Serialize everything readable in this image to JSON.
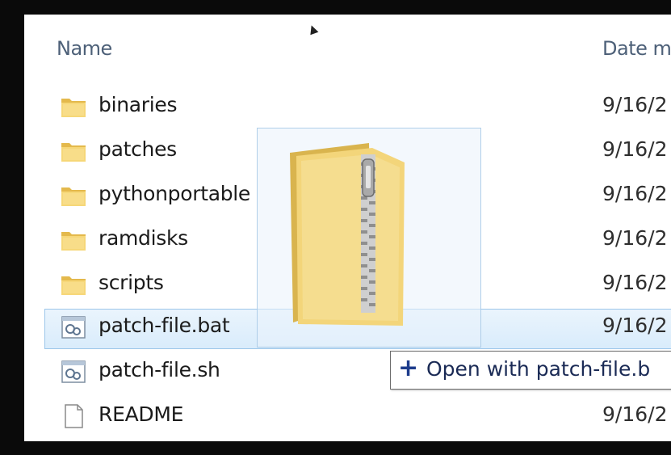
{
  "columns": {
    "name": "Name",
    "date": "Date m"
  },
  "files": [
    {
      "name": "binaries",
      "date": "9/16/2",
      "type": "folder"
    },
    {
      "name": "patches",
      "date": "9/16/2",
      "type": "folder"
    },
    {
      "name": "pythonportable",
      "date": "9/16/2",
      "type": "folder"
    },
    {
      "name": "ramdisks",
      "date": "9/16/2",
      "type": "folder"
    },
    {
      "name": "scripts",
      "date": "9/16/2",
      "type": "folder"
    },
    {
      "name": "patch-file.bat",
      "date": "9/16/2",
      "type": "script",
      "selected": true
    },
    {
      "name": "patch-file.sh",
      "date": "",
      "type": "script"
    },
    {
      "name": "README",
      "date": "9/16/2",
      "type": "file"
    }
  ],
  "drag": {
    "icon": "zip-folder-icon"
  },
  "tooltip": {
    "icon": "plus-icon",
    "text": "Open with patch-file.b"
  }
}
